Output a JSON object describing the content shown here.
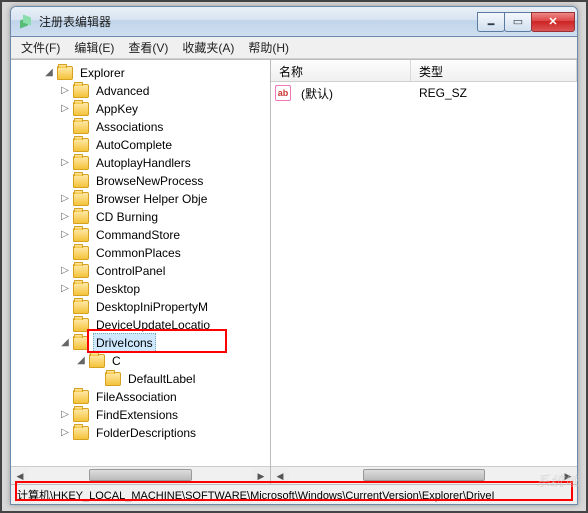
{
  "window": {
    "title": "注册表编辑器"
  },
  "menu": {
    "file": "文件(F)",
    "edit": "编辑(E)",
    "view": "查看(V)",
    "fav": "收藏夹(A)",
    "help": "帮助(H)"
  },
  "tree": {
    "n0": "Explorer",
    "n1": "Advanced",
    "n2": "AppKey",
    "n3": "Associations",
    "n4": "AutoComplete",
    "n5": "AutoplayHandlers",
    "n6": "BrowseNewProcess",
    "n7": "Browser Helper Obje",
    "n8": "CD Burning",
    "n9": "CommandStore",
    "n10": "CommonPlaces",
    "n11": "ControlPanel",
    "n12": "Desktop",
    "n13": "DesktopIniPropertyM",
    "n14": "DeviceUpdateLocatio",
    "n15": "DriveIcons",
    "n16": "C",
    "n17": "DefaultLabel",
    "n18": "FileAssociation",
    "n19": "FindExtensions",
    "n20": "FolderDescriptions"
  },
  "list": {
    "col_name": "名称",
    "col_type": "类型",
    "rows": [
      {
        "name": "(默认)",
        "type": "REG_SZ"
      }
    ]
  },
  "status": {
    "path": "计算机\\HKEY_LOCAL_MACHINE\\SOFTWARE\\Microsoft\\Windows\\CurrentVersion\\Explorer\\DriveI"
  },
  "watermark": "系统域"
}
